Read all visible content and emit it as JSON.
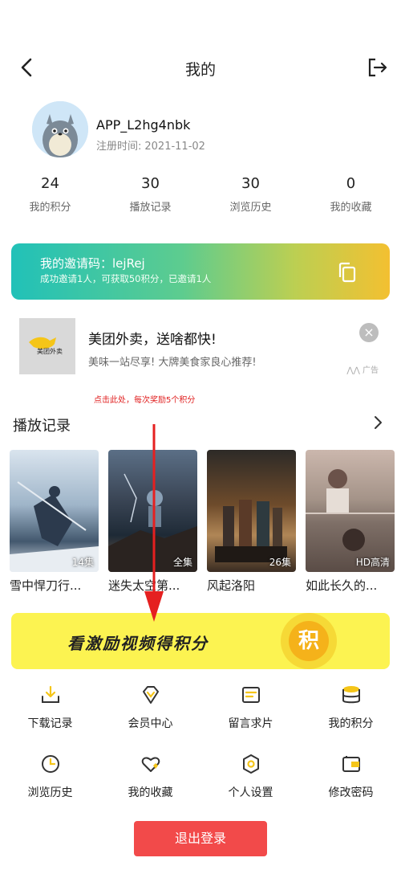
{
  "header": {
    "title": "我的"
  },
  "profile": {
    "username": "APP_L2hg4nbk",
    "reg_label": "注册时间:",
    "reg_date": "2021-11-02"
  },
  "stats": [
    {
      "value": "24",
      "label": "我的积分"
    },
    {
      "value": "30",
      "label": "播放记录"
    },
    {
      "value": "30",
      "label": "浏览历史"
    },
    {
      "value": "0",
      "label": "我的收藏"
    }
  ],
  "invite": {
    "code_text": "我的邀请码：lejRej",
    "subtitle": "成功邀请1人，可获取50积分，已邀请1人"
  },
  "ad": {
    "image_text": "美团外卖",
    "title": "美团外卖，送啥都快!",
    "desc": "美味一站尽享! 大牌美食家良心推荐!",
    "tag": "广告"
  },
  "reward_tip": "点击此处，每次奖励5个积分",
  "history": {
    "title": "播放记录",
    "items": [
      {
        "name": "雪中悍刀行...",
        "badge": "14集"
      },
      {
        "name": "迷失太空第...",
        "badge": "全集"
      },
      {
        "name": "风起洛阳",
        "badge": "26集"
      },
      {
        "name": "如此长久的...",
        "badge": "HD高清"
      }
    ]
  },
  "video_banner": {
    "text": "看激励视频得积分",
    "coin": "积"
  },
  "menu": [
    {
      "label": "下载记录",
      "icon": "download-icon"
    },
    {
      "label": "会员中心",
      "icon": "diamond-icon"
    },
    {
      "label": "留言求片",
      "icon": "message-board-icon"
    },
    {
      "label": "我的积分",
      "icon": "coins-icon"
    },
    {
      "label": "浏览历史",
      "icon": "clock-icon"
    },
    {
      "label": "我的收藏",
      "icon": "heart-icon"
    },
    {
      "label": "个人设置",
      "icon": "settings-icon"
    },
    {
      "label": "修改密码",
      "icon": "wallet-lock-icon"
    }
  ],
  "logout_button": "退出登录",
  "colors": {
    "accent": "#f24a4a",
    "banner": "#fcf351",
    "icon_yellow": "#f5c518"
  }
}
